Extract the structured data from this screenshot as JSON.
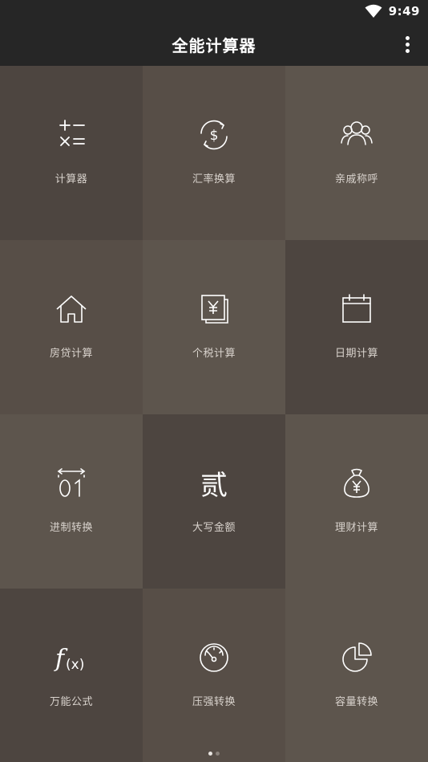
{
  "status_bar": {
    "time": "9:49"
  },
  "app_bar": {
    "title": "全能计算器"
  },
  "tiles": [
    {
      "label": "计算器"
    },
    {
      "label": "汇率换算"
    },
    {
      "label": "亲戚称呼"
    },
    {
      "label": "房贷计算"
    },
    {
      "label": "个税计算"
    },
    {
      "label": "日期计算"
    },
    {
      "label": "进制转换"
    },
    {
      "label": "大写金额"
    },
    {
      "label": "理财计算"
    },
    {
      "label": "万能公式"
    },
    {
      "label": "压强转换"
    },
    {
      "label": "容量转换"
    }
  ],
  "pager": {
    "pages": 2,
    "current": 1
  }
}
